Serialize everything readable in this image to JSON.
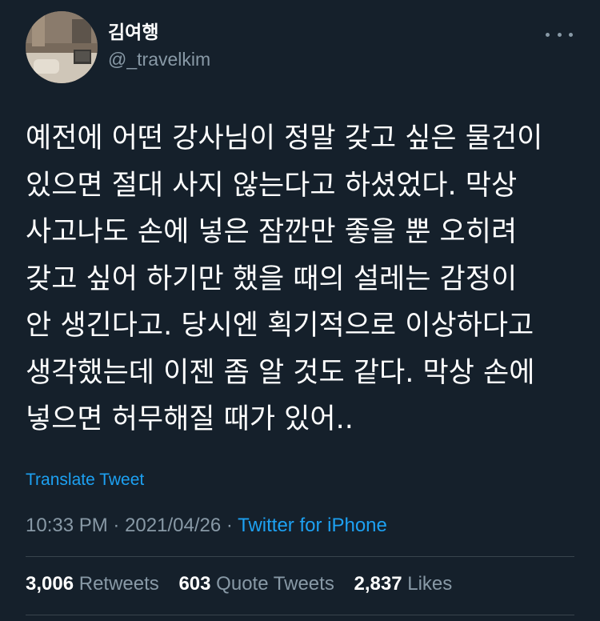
{
  "author": {
    "display_name": "김여행",
    "handle": "@_travelkim"
  },
  "tweet": {
    "text": "예전에 어떤 강사님이 정말 갖고 싶은 물건이\n있으면 절대 사지 않는다고 하셨었다. 막상\n사고나도 손에 넣은 잠깐만 좋을 뿐 오히려\n갖고 싶어 하기만 했을 때의 설레는 감정이\n안 생긴다고. 당시엔 획기적으로 이상하다고\n생각했는데 이젠 좀 알 것도 같다. 막상 손에\n넣으면 허무해질 때가 있어..",
    "translate_label": "Translate Tweet",
    "time": "10:33 PM",
    "date": "2021/04/26",
    "separator": "·",
    "source": "Twitter for iPhone"
  },
  "stats": {
    "retweets": "3,006",
    "retweets_label": "Retweets",
    "quotes": "603",
    "quotes_label": "Quote Tweets",
    "likes": "2,837",
    "likes_label": "Likes"
  },
  "icons": {
    "more": "more-horizontal-icon"
  },
  "colors": {
    "background": "#15202b",
    "accent": "#1da1f2",
    "secondary_text": "#8899a6",
    "divider": "#38444d"
  }
}
